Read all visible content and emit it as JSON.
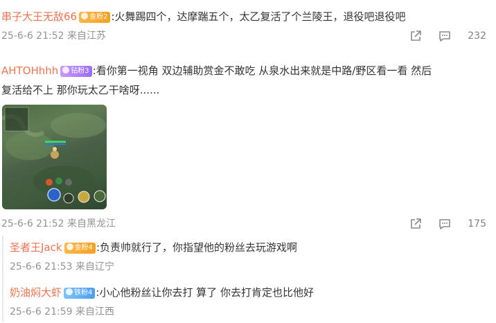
{
  "comments": [
    {
      "user": "串子大王无敌66",
      "badge": "金粉2",
      "text": ":火舞踢四个，达摩踹五个，太乙复活了个兰陵王，退役吧退役吧",
      "meta": "25-6-6 21:52 来自江苏",
      "likes": "232"
    },
    {
      "user": "AHTOHhhh",
      "badge": "钻粉3",
      "text_line1": ":看你第一视角 双边辅助赏金不敢吃  从泉水出来就是中路/野区看一看 然后",
      "text_line2": "复活给不上 那你玩太乙干啥呀......",
      "meta": "25-6-6 21:52 来自黑龙江",
      "likes": "175",
      "image": "game-screenshot"
    }
  ],
  "replies": [
    {
      "user": "圣者王Jack",
      "badge": "金粉4",
      "text": ":负责帅就行了，你指望他的粉丝去玩游戏啊",
      "meta": "25-6-6 21:53 来自辽宁"
    },
    {
      "user": "奶油焖大虾",
      "badge": "铁粉4",
      "text": ":小心他粉丝让你去打 算了 你去打肯定也比他好",
      "meta": "25-6-6 21:59 来自江西"
    }
  ],
  "icons": [
    "share-icon",
    "comment-icon",
    "like-icon",
    "crown-icon",
    "diamond-icon"
  ],
  "colors": {
    "username": "#eb7350",
    "meta": "#939393",
    "badge_gold": "#f5a020",
    "badge_purple": "#9b6bf2",
    "badge_blue": "#4a9ef2"
  }
}
